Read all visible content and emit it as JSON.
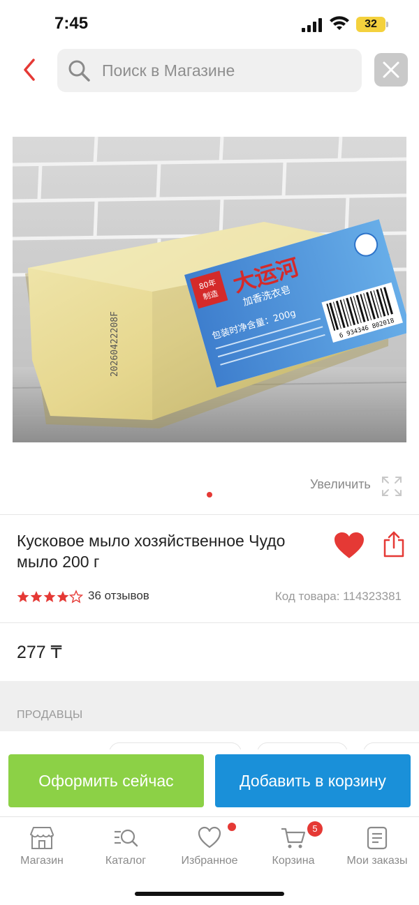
{
  "status_bar": {
    "time": "7:45",
    "battery": "32"
  },
  "header": {
    "search_placeholder": "Поиск в Магазине"
  },
  "gallery": {
    "zoom_label": "Увеличить",
    "package_brand": "大运河",
    "package_subtitle": "加香洗衣皂",
    "package_badge_line1": "80年",
    "package_badge_line2": "制造",
    "package_weight": "包装时净含量：200g",
    "package_barcode": "6 934346 802018",
    "package_lot": "20260422208F"
  },
  "product": {
    "title": "Кусковое мыло хозяйственное Чудо мыло 200 г",
    "rating": 4.5,
    "reviews": "36 отзывов",
    "code": "Код товара: 114323381",
    "price": "277 ₸"
  },
  "sellers": {
    "title": "ПРОДАВЦЫ"
  },
  "actions": {
    "order_label": "Оформить сейчас",
    "cart_label": "Добавить в корзину"
  },
  "nav": {
    "items": [
      {
        "label": "Магазин",
        "icon": "shop-icon"
      },
      {
        "label": "Каталог",
        "icon": "catalog-search-icon"
      },
      {
        "label": "Избранное",
        "icon": "heart-outline-icon"
      },
      {
        "label": "Корзина",
        "icon": "cart-icon",
        "badge": "5"
      },
      {
        "label": "Мои заказы",
        "icon": "orders-icon"
      }
    ]
  },
  "colors": {
    "accent_red": "#e53935",
    "order_green": "#8cd146",
    "cart_blue": "#1a90d9"
  }
}
